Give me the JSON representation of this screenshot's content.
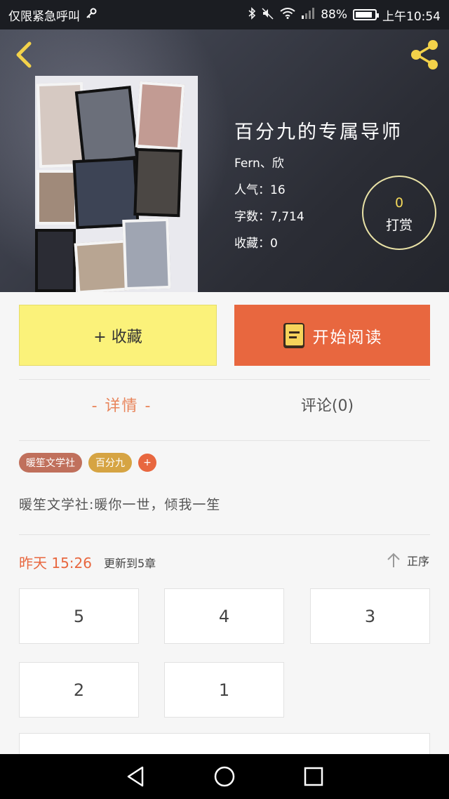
{
  "status_bar": {
    "carrier": "仅限紧急呼叫",
    "battery": "88%",
    "battery_level": 0.88,
    "time": "上午10:54"
  },
  "book": {
    "title": "百分九的专属导师",
    "author": "Fern、欣",
    "popularity": "人气：16",
    "word_count": "字数：7,714",
    "favorites": "收藏：0",
    "reward_count": "0",
    "reward_label": "打赏"
  },
  "actions": {
    "favorite_label": "+ 收藏",
    "read_label": "开始阅读"
  },
  "tabs": {
    "detail": "- 详情 -",
    "comments": "评论(0)"
  },
  "tags": [
    {
      "label": "暖笙文学社",
      "color": "#c0705c"
    },
    {
      "label": "百分九",
      "color": "#d6a443"
    }
  ],
  "tag_add": "+",
  "summary": "暖笙文学社:暖你一世，倾我一笙",
  "update": {
    "time": "昨天 15:26",
    "text": "更新到5章",
    "sort_label": "正序"
  },
  "chapters": [
    "5",
    "4",
    "3",
    "2",
    "1"
  ],
  "colors": {
    "accent": "#e8673f",
    "favorite_bg": "#fbf27a",
    "tab_active": "#e8845a"
  }
}
